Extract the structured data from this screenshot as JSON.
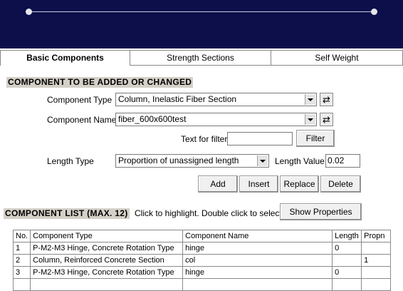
{
  "tabs": [
    "Basic Components",
    "Strength Sections",
    "Self Weight"
  ],
  "edit_section": {
    "title": "COMPONENT TO BE ADDED OR CHANGED",
    "component_type_label": "Component Type",
    "component_type_value": "Column, Inelastic Fiber Section",
    "component_name_label": "Component Name",
    "component_name_value": "fiber_600x600test",
    "filter_label": "Text for filter",
    "filter_value": "",
    "filter_button": "Filter",
    "length_type_label": "Length Type",
    "length_type_value": "Proportion of unassigned length",
    "length_value_label": "Length Value",
    "length_value": "0.02",
    "buttons": {
      "add": "Add",
      "insert": "Insert",
      "replace": "Replace",
      "delete": "Delete"
    }
  },
  "list_section": {
    "title": "COMPONENT LIST (MAX. 12)",
    "hint": "Click to highlight.  Double click to select.",
    "show_properties": "Show Properties",
    "columns": [
      "No.",
      "Component Type",
      "Component Name",
      "Length",
      "Propn"
    ],
    "rows": [
      {
        "no": "1",
        "type": "P-M2-M3 Hinge, Concrete Rotation Type",
        "name": "hinge",
        "length": "0",
        "propn": ""
      },
      {
        "no": "2",
        "type": "Column, Reinforced Concrete Section",
        "name": "col",
        "length": "",
        "propn": "1"
      },
      {
        "no": "3",
        "type": "P-M2-M3 Hinge, Concrete Rotation Type",
        "name": "hinge",
        "length": "0",
        "propn": ""
      },
      {
        "no": "",
        "type": "",
        "name": "",
        "length": "",
        "propn": ""
      }
    ]
  }
}
